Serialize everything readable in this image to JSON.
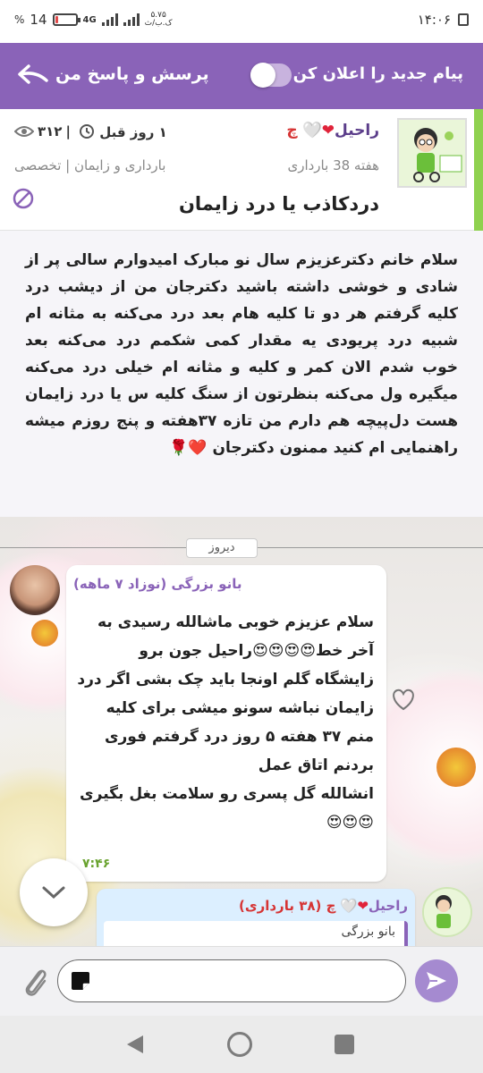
{
  "status_bar": {
    "battery": "14",
    "battery_percent": "%",
    "battery_level": 0.14,
    "network": "4G",
    "speed_value": "۵.۷۵",
    "speed_unit": "ک.ب/ث",
    "time": "۱۴:۰۶"
  },
  "header": {
    "title": "پرسش و پاسخ من",
    "notify_label": "پیام جدید را اعلان کن",
    "notify_enabled": false
  },
  "post": {
    "author_name": "راحیل",
    "author_suffix": "چ",
    "week": "هفته 38 بارداری",
    "time_ago": "۱ روز قبل",
    "views": "۳۱۲",
    "category": "بارداری و زایمان | تخصصی",
    "title": "دردکاذب یا درد زایمان"
  },
  "question": {
    "text": "سلام خانم دکترعزیزم سال نو مبارک امیدوارم سالی پر از شادی و خوشی داشته باشید دکترجان من از دیشب درد کلیه گرفتم هر دو تا کلیه هام بعد درد می‌کنه به مثانه ام شبیه درد پریودی یه مقدار کمی شکمم درد می‌کنه بعد خوب شدم الان کمر و کلیه و مثانه ام خیلی درد می‌کنه میگیره ول می‌کنه بنظرتون از سنگ کلیه س یا درد زایمان هست دل‌پیچه هم دارم من تازه ۳۷هفته و پنج روزم میشه راهنمایی ام کنید ممنون دکترجان ❤️🌹"
  },
  "chat": {
    "date_separator": "دیروز",
    "messages": [
      {
        "sender": "بانو بزرگی (نوزاد ۷ ماهه)",
        "text": "سلام عزیزم خوبی ماشالله رسیدی به آخر خط😍😍😍😍راحیل جون برو زایشگاه گلم اونجا باید چک بشی اگر درد زایمان نباشه سونو میشی برای کلیه\nمنم ۳۷ هفته ۵ روز درد گرفتم فوری بردنم اتاق عمل\nانشالله گل پسری رو سلامت بغل بگیری😍😍😍",
        "time": "۷:۴۶"
      },
      {
        "sender_name": "راحیل",
        "sender_suffix": "چ (۳۸ بارداری)",
        "quote_author": "بانو بزرگی"
      }
    ]
  },
  "input": {
    "placeholder": "",
    "value": ""
  },
  "colors": {
    "accent": "#8a63b8",
    "green": "#8fd14f",
    "heart": "#e0233a",
    "time_green": "#6aa330"
  }
}
